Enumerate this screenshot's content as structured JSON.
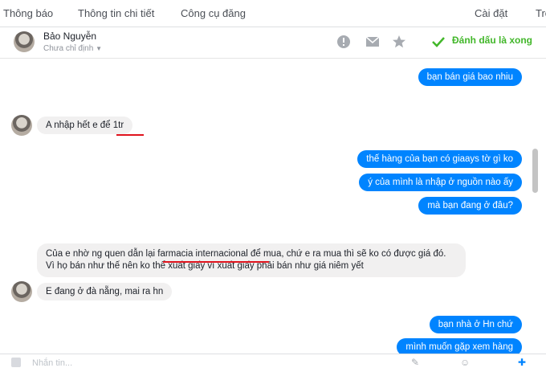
{
  "topnav": {
    "notifications": "Thông báo",
    "details": "Thông tin chi tiết",
    "publishing_tools": "Công cụ đăng",
    "settings": "Cài đặt",
    "truncated": "Trợ"
  },
  "conversation_header": {
    "name": "Bảo Nguyễn",
    "assignee": "Chưa chỉ định",
    "mark_done": "Đánh dấu là xong"
  },
  "messages": [
    {
      "dir": "out",
      "text": "bạn bán giá bao nhiu"
    },
    {
      "dir": "in",
      "text_before": "A nhập hết e để ",
      "text_underlined": "1tr"
    },
    {
      "dir": "out",
      "text": "thế hàng của bạn có giaays tờ gì ko"
    },
    {
      "dir": "out",
      "text": "ý của mình là nhập ở nguồn nào ấy"
    },
    {
      "dir": "out",
      "text": "mà bạn đang ở đâu?"
    },
    {
      "dir": "in",
      "text_before": "Của e nhờ ng quen dẫn lại ",
      "text_underlined": "farmacia internacional",
      "text_after": " để mua, chứ e ra mua thì sẽ ko có được giá đó. Vì họ bán như thế nên ko thể xuất giấy vì xuất giấy phải bán như giá niêm yết"
    },
    {
      "dir": "in",
      "text": "E đang ở đà nẵng, mai ra hn"
    },
    {
      "dir": "out",
      "text": "bạn nhà ở Hn chứ"
    },
    {
      "dir": "out",
      "text": "mình muốn gặp xem hàng"
    }
  ],
  "composer": {
    "placeholder": "Nhắn tin..."
  },
  "colors": {
    "accent": "#0084ff",
    "done_green": "#42b72a",
    "underline_red": "#e0141e",
    "incoming_bg": "#f1f0f0"
  }
}
